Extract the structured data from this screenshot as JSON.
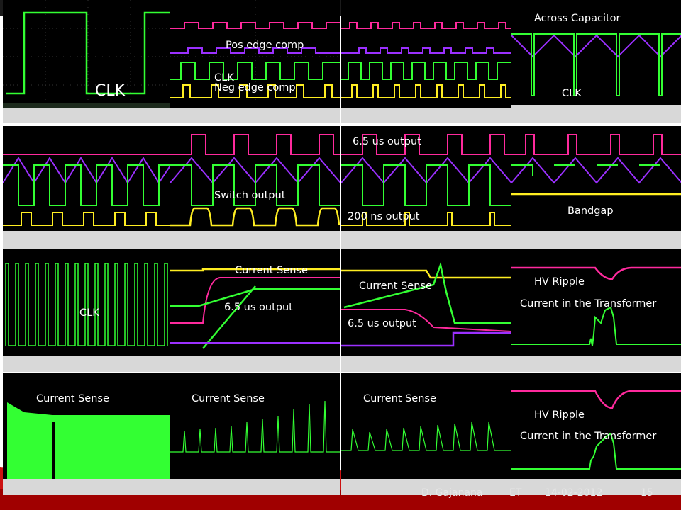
{
  "labels": {
    "clk_big": "CLK",
    "pos_edge_comp": "Pos edge comp",
    "clk_p2": "CLK",
    "neg_edge_comp": "Neg edge comp",
    "across_capacitor": "Across Capacitor",
    "clk_p4": "CLK",
    "switch_output": "Switch output",
    "us_output_65_p7": "6.5 us output",
    "ns_output_200": "200 ns output",
    "bandgap": "Bandgap",
    "clk_p9": "CLK",
    "current_sense_p10": "Current Sense",
    "us_output_65_p10": "6.5 us output",
    "current_sense_p11": "Current Sense",
    "us_output_65_p11": "6.5 us output",
    "hv_ripple_p12": "HV Ripple",
    "current_transformer_p12": "Current in the Transformer",
    "current_sense_p13": "Current Sense",
    "current_sense_p14": "Current Sense",
    "current_sense_p15": "Current Sense",
    "hv_ripple_p16": "HV Ripple",
    "current_transformer_p16": "Current in the Transformer"
  },
  "footer": {
    "author": "D. Gajanana",
    "org": "ET",
    "date": "14-02-2012",
    "page": "15"
  },
  "colors": {
    "trace_green": "#33ff33",
    "trace_magenta": "#ff2a9d",
    "trace_purple": "#9b30ff",
    "trace_yellow": "#ffee22",
    "screen_bg": "#000000",
    "softkey_bar": "#d8d8d8"
  }
}
